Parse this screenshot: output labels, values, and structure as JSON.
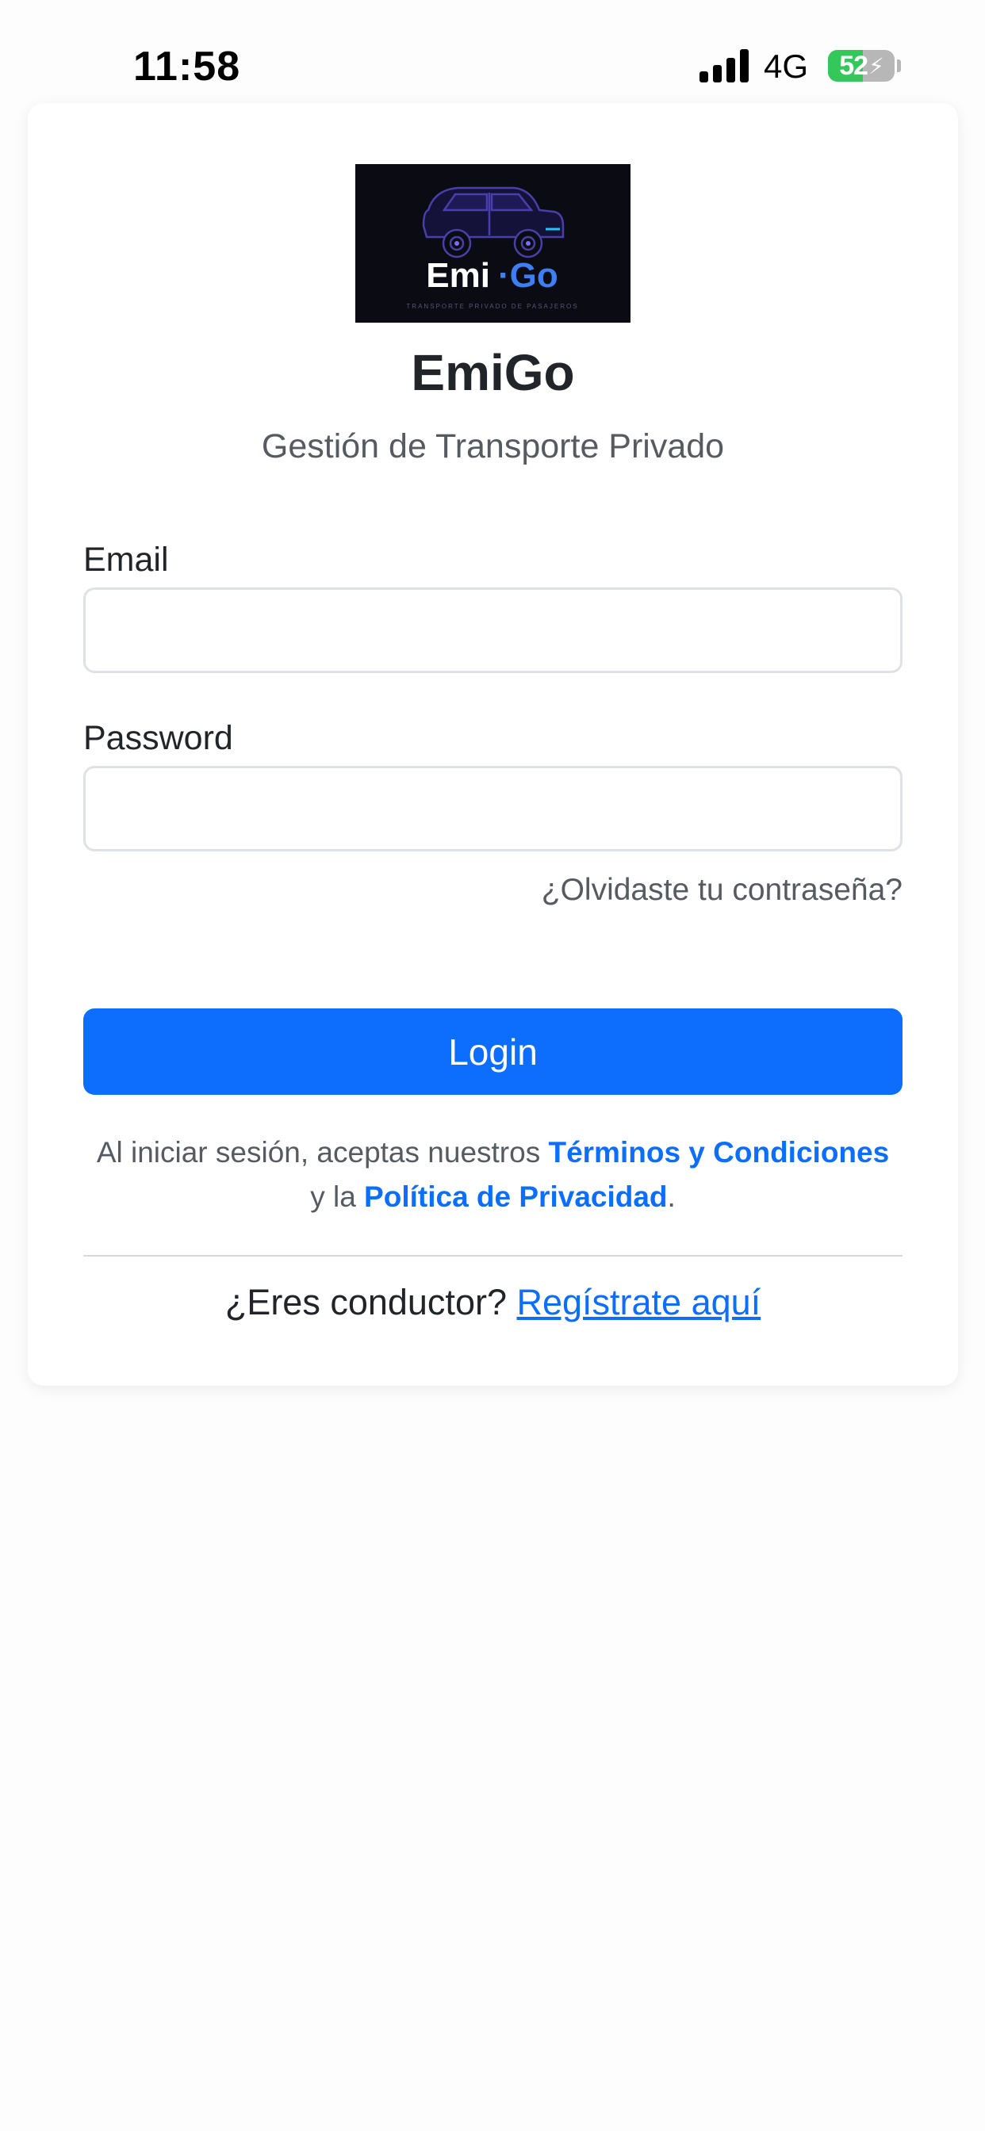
{
  "status_bar": {
    "time": "11:58",
    "network": "4G",
    "battery_percent": 52,
    "battery_label": "52",
    "battery_charging": true,
    "signal_icon": "cellular-signal-icon",
    "battery_icon": "battery-charging-icon"
  },
  "logo": {
    "word_primary": "Emi",
    "word_secondary": "·Go",
    "tagline": "TRANSPORTE PRIVADO DE PASAJEROS",
    "icon": "car-icon"
  },
  "header": {
    "title": "EmiGo",
    "subtitle": "Gestión de Transporte Privado"
  },
  "form": {
    "email_label": "Email",
    "email_value": "",
    "email_placeholder": "",
    "password_label": "Password",
    "password_value": "",
    "password_placeholder": "",
    "forgot_password": "¿Olvidaste tu contraseña?",
    "login_label": "Login"
  },
  "terms": {
    "prefix": "Al iniciar sesión, aceptas nuestros ",
    "terms_link": "Términos y Condiciones",
    "middle": " y la ",
    "privacy_link": "Política de Privacidad",
    "suffix": "."
  },
  "driver": {
    "question": "¿Eres conductor? ",
    "register_link": "Regístrate aquí"
  },
  "colors": {
    "primary": "#0d6efd",
    "page_background": "#fdfdfd",
    "card_background": "#ffffff",
    "logo_background": "#0b0b13",
    "battery_green": "#34c759"
  }
}
